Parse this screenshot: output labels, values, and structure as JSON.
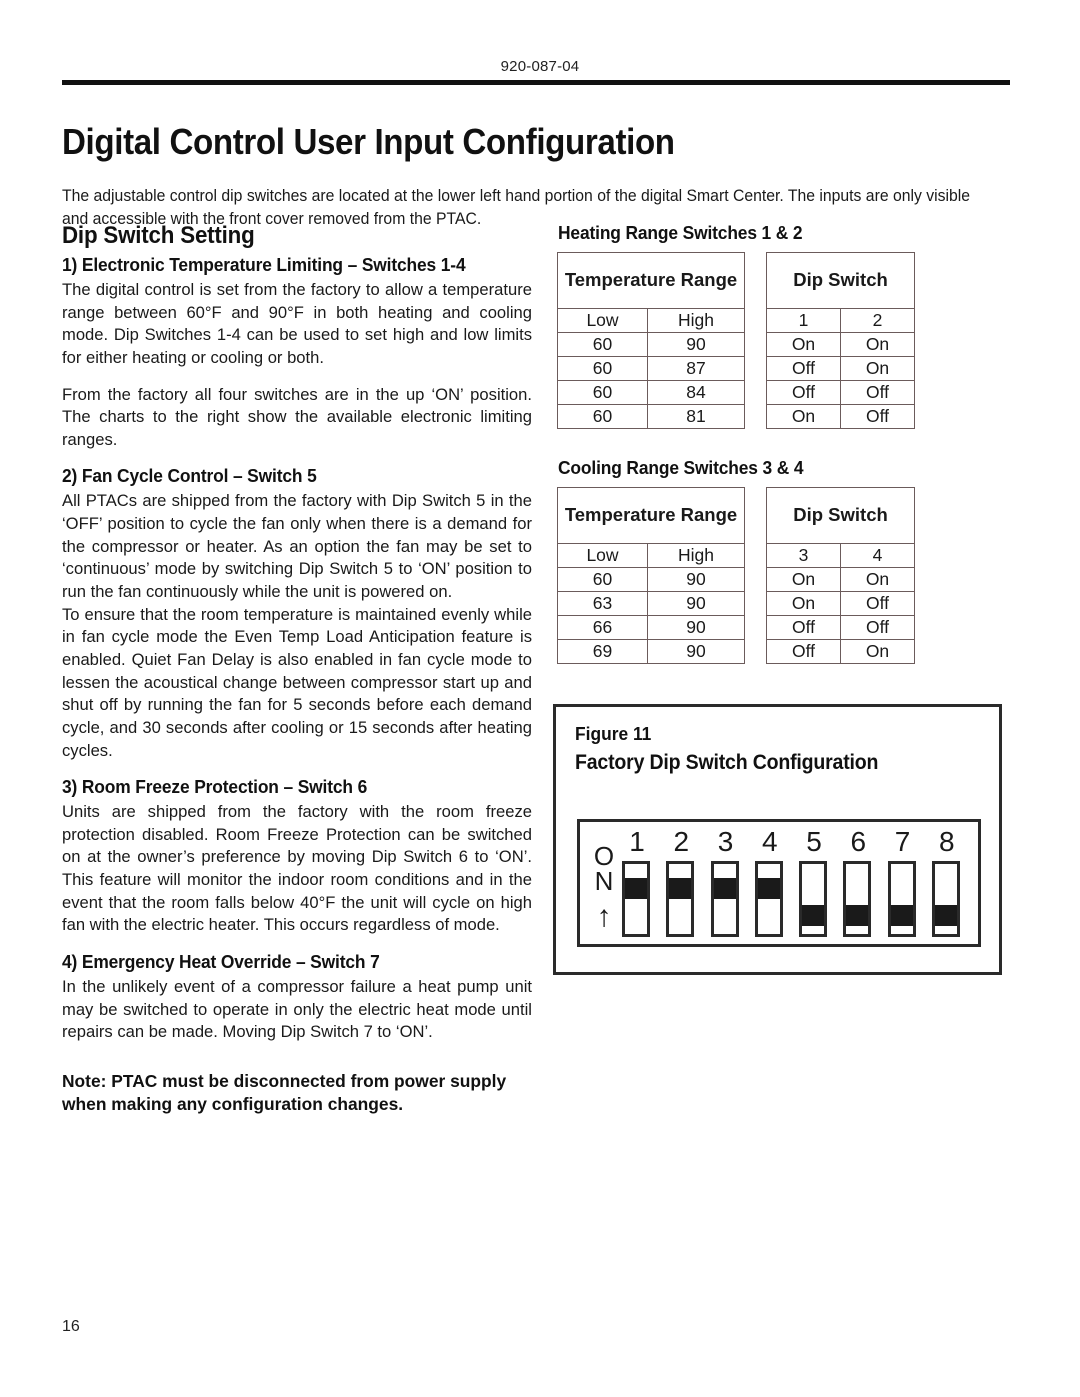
{
  "header": {
    "doc_code": "920-087-04"
  },
  "title": "Digital Control User Input Configuration",
  "intro": "The adjustable control dip switches are located at the lower left hand portion of the digital Smart Center.  The inputs are only visible and accessible with the front cover removed from the PTAC.",
  "left_column": {
    "section_heading": "Dip Switch Setting",
    "items": [
      {
        "heading": "1) Electronic Temperature Limiting – Switches 1-4",
        "paragraphs": [
          "The digital control is set from the factory to allow a temperature range between 60°F and 90°F in both heating and cooling mode. Dip Switches 1-4 can be used to set high and low limits for either heating or cooling or both.",
          "From the factory all four switches are in the up ‘ON’ position. The charts to the right show the available electronic limiting ranges."
        ]
      },
      {
        "heading": "2) Fan Cycle Control – Switch 5",
        "paragraphs": [
          "All PTACs are shipped from the factory with Dip Switch 5 in the ‘OFF’ position to cycle the fan only when there is a demand for the compressor or heater. As an option the fan may be set to ‘continuous’ mode by switching Dip Switch 5 to ‘ON’ position to run the fan continuously while the unit is powered on.",
          "To ensure that the room temperature is maintained evenly while in fan cycle mode the Even Temp Load Anticipation feature is enabled. Quiet Fan Delay is also enabled in fan cycle mode to lessen the acoustical change between compressor start up and shut off by running the fan for 5 seconds before each demand cycle, and 30 seconds after cooling or 15 seconds after heating cycles."
        ]
      },
      {
        "heading": "3) Room Freeze Protection – Switch 6",
        "paragraphs": [
          "Units are shipped from the factory with the room freeze protection disabled. Room Freeze Protection can be switched on at the owner’s preference by moving Dip Switch 6 to ‘ON’. This feature will monitor the indoor room conditions and in the event that the room falls below 40°F the unit will cycle on high fan with the electric heater. This occurs regardless of mode."
        ]
      },
      {
        "heading": "4) Emergency Heat Override – Switch 7",
        "paragraphs": [
          "In the unlikely event of a compressor failure a heat pump unit may be switched to operate in only the electric heat mode until repairs can be made. Moving Dip Switch 7 to ‘ON’."
        ]
      }
    ],
    "note": "Note: PTAC must be disconnected from power supply when making any configuration changes."
  },
  "tables": {
    "heating": {
      "caption": "Heating Range Switches 1 & 2",
      "range_group_header": "Temperature Range",
      "switch_group_header": "Dip Switch",
      "range_columns": [
        "Low",
        "High"
      ],
      "switch_columns": [
        "1",
        "2"
      ],
      "rows": [
        {
          "low": "60",
          "high": "90",
          "sw_a": "On",
          "sw_b": "On"
        },
        {
          "low": "60",
          "high": "87",
          "sw_a": "Off",
          "sw_b": "On"
        },
        {
          "low": "60",
          "high": "84",
          "sw_a": "Off",
          "sw_b": "Off"
        },
        {
          "low": "60",
          "high": "81",
          "sw_a": "On",
          "sw_b": "Off"
        }
      ]
    },
    "cooling": {
      "caption": "Cooling Range Switches 3 & 4",
      "range_group_header": "Temperature Range",
      "switch_group_header": "Dip Switch",
      "range_columns": [
        "Low",
        "High"
      ],
      "switch_columns": [
        "3",
        "4"
      ],
      "rows": [
        {
          "low": "60",
          "high": "90",
          "sw_a": "On",
          "sw_b": "On"
        },
        {
          "low": "63",
          "high": "90",
          "sw_a": "On",
          "sw_b": "Off"
        },
        {
          "low": "66",
          "high": "90",
          "sw_a": "Off",
          "sw_b": "Off"
        },
        {
          "low": "69",
          "high": "90",
          "sw_a": "Off",
          "sw_b": "On"
        }
      ]
    }
  },
  "figure": {
    "label": "Figure 11",
    "title": "Factory Dip Switch Configuration",
    "on_label_line1": "O",
    "on_label_line2": "N",
    "on_arrow": "↑",
    "switches": [
      {
        "number": "1",
        "position": "on"
      },
      {
        "number": "2",
        "position": "on"
      },
      {
        "number": "3",
        "position": "on"
      },
      {
        "number": "4",
        "position": "on"
      },
      {
        "number": "5",
        "position": "off"
      },
      {
        "number": "6",
        "position": "off"
      },
      {
        "number": "7",
        "position": "off"
      },
      {
        "number": "8",
        "position": "off"
      }
    ]
  },
  "footer": {
    "page_number": "16"
  }
}
